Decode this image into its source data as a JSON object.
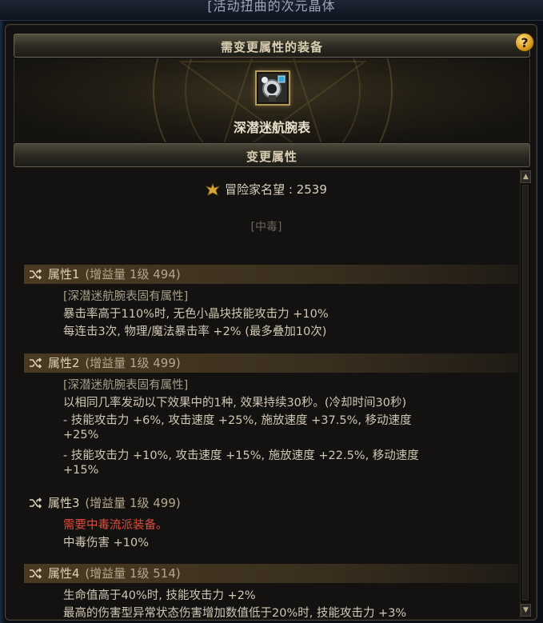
{
  "top_title": "[活动扭曲的次元晶体",
  "header": {
    "title": "需变更属性的装备",
    "help": "?"
  },
  "item": {
    "name": "深潜迷航腕表"
  },
  "section": {
    "title": "变更属性"
  },
  "fame": {
    "label": "冒险家名望 : 2539"
  },
  "tag": "[中毒]",
  "attributes": [
    {
      "title": "属性1",
      "level": "(增益量 1级 494)",
      "lines": [
        "[深潜迷航腕表固有属性]",
        "暴击率高于110%时, 无色小晶块技能攻击力 +10%",
        "每连击3次, 物理/魔法暴击率 +2% (最多叠加10次)"
      ]
    },
    {
      "title": "属性2",
      "level": "(增益量 1级 499)",
      "lines": [
        "[深潜迷航腕表固有属性]",
        "以相同几率发动以下效果中的1种, 效果持续30秒。(冷却时间30秒)",
        "- 技能攻击力 +6%, 攻击速度 +25%, 施放速度 +37.5%, 移动速度",
        "+25%",
        "- 技能攻击力 +10%, 攻击速度 +15%, 施放速度 +22.5%, 移动速度",
        "+15%"
      ]
    },
    {
      "title": "属性3",
      "level": "(增益量 1级 499)",
      "lines": [
        "需要中毒流派装备。",
        "中毒伤害 +10%"
      ]
    },
    {
      "title": "属性4",
      "level": "(增益量 1级 514)",
      "lines": [
        "生命值高于40%时, 技能攻击力 +2%",
        "最高的伤害型异常状态伤害增加数值低于20%时, 技能攻击力 +3%"
      ]
    }
  ],
  "colors": {
    "red_text": "#e04a3a",
    "gold_border": "#b29a5e"
  },
  "icons": {
    "help": "question-icon",
    "fame": "fame-crest-icon",
    "shuffle": "shuffle-icon",
    "item": "watch-icon"
  }
}
